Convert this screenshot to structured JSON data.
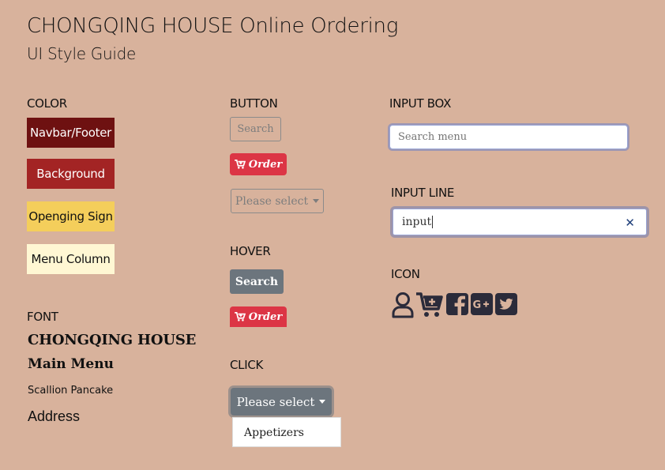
{
  "page": {
    "title": "CHONGQING HOUSE Online Ordering",
    "subtitle": "UI Style Guide"
  },
  "color_section": {
    "heading": "COLOR",
    "swatches": [
      {
        "label": "Navbar/Footer",
        "color": "#6e1111",
        "text_color": "#ffffff"
      },
      {
        "label": "Background",
        "color": "#a32424",
        "text_color": "#ffffff"
      },
      {
        "label": "Openging Sign",
        "color": "#f4ce5b",
        "text_color": "#111111"
      },
      {
        "label": "Menu Column",
        "color": "#fff7d3",
        "text_color": "#111111"
      }
    ]
  },
  "font_section": {
    "heading": "FONT",
    "samples": [
      "CHONGQING HOUSE",
      "Main Menu",
      "Scallion Pancake",
      "Address"
    ]
  },
  "button_section": {
    "heading": "BUTTON",
    "search_label": "Search",
    "order_label": "Order",
    "select_label": "Please select"
  },
  "hover_section": {
    "heading": "HOVER",
    "search_label": "Search",
    "order_label": "Order"
  },
  "click_section": {
    "heading": "CLICK",
    "select_label": "Please select",
    "dropdown_items": [
      "Appetizers"
    ]
  },
  "input_box_section": {
    "heading": "INPUT BOX",
    "placeholder": "Search menu"
  },
  "input_line_section": {
    "heading": "INPUT LINE",
    "value": "input"
  },
  "icon_section": {
    "heading": "ICON",
    "icons": [
      "user-icon",
      "add-to-cart-icon",
      "facebook-icon",
      "google-plus-icon",
      "twitter-icon"
    ]
  },
  "colors": {
    "page_background": "#d8b29c",
    "order_red": "#dc3545",
    "hover_gray": "#6c757d",
    "icon_dark": "#2b2b3a"
  }
}
